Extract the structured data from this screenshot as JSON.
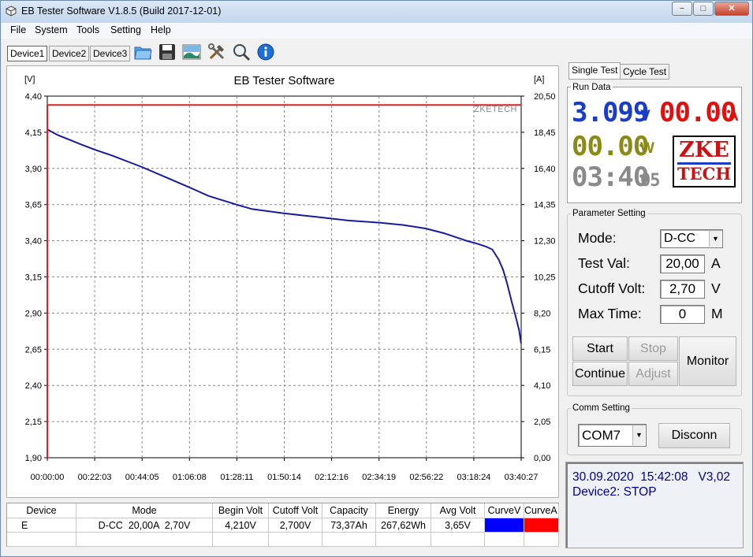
{
  "window": {
    "title": "EB Tester Software V1.8.5 (Build 2017-12-01)",
    "minimize_label": "−",
    "maximize_label": "□",
    "close_label": "✕"
  },
  "menu": [
    "File",
    "System",
    "Tools",
    "Setting",
    "Help"
  ],
  "device_tabs": [
    "Device1",
    "Device2",
    "Device3"
  ],
  "toolbar_icons": [
    "open-folder-icon",
    "save-icon",
    "chart-image-icon",
    "tools-icon",
    "zoom-icon",
    "info-icon"
  ],
  "chart_data": {
    "type": "line",
    "title": "EB Tester Software",
    "watermark": "ZKETECH",
    "ylabel_left": "[V]",
    "ylabel_right": "[A]",
    "y_left_ticks": [
      "4,40",
      "4,15",
      "3,90",
      "3,65",
      "3,40",
      "3,15",
      "2,90",
      "2,65",
      "2,40",
      "2,15",
      "1,90"
    ],
    "y_right_ticks": [
      "20,50",
      "18,45",
      "16,40",
      "14,35",
      "12,30",
      "10,25",
      "8,20",
      "6,15",
      "4,10",
      "2,05",
      "0,00"
    ],
    "x_ticks": [
      "00:00:00",
      "00:22:03",
      "00:44:05",
      "01:06:08",
      "01:28:11",
      "01:50:14",
      "02:12:16",
      "02:34:19",
      "02:56:22",
      "03:18:24",
      "03:40:27"
    ],
    "ylim_left": [
      1.9,
      4.4
    ],
    "ylim_right": [
      0,
      20.5
    ],
    "xlim_minutes": [
      0,
      220.45
    ],
    "grid": true,
    "series": [
      {
        "axis": "left",
        "color": "#1a1aa0",
        "x_minutes": [
          0,
          5,
          10,
          15,
          22,
          30,
          44,
          55,
          66,
          75,
          88,
          95,
          110,
          125,
          140,
          155,
          165,
          176,
          185,
          195,
          200,
          204,
          207,
          210,
          212,
          214,
          216,
          218,
          219.5,
          220.4
        ],
        "y_volts": [
          4.17,
          4.13,
          4.1,
          4.07,
          4.03,
          3.99,
          3.91,
          3.84,
          3.77,
          3.71,
          3.65,
          3.62,
          3.59,
          3.565,
          3.54,
          3.525,
          3.51,
          3.485,
          3.45,
          3.4,
          3.38,
          3.36,
          3.34,
          3.27,
          3.2,
          3.1,
          2.98,
          2.87,
          2.78,
          2.69
        ]
      },
      {
        "axis": "right",
        "color": "#e02020",
        "x_minutes": [
          0,
          0,
          220.45
        ],
        "y_amps": [
          0,
          20.0,
          20.0
        ]
      }
    ]
  },
  "table": {
    "headers": [
      "Device",
      "Mode",
      "Begin Volt",
      "Cutoff Volt",
      "Capacity",
      "Energy",
      "Avg Volt",
      "CurveV",
      "CurveA"
    ],
    "row": {
      "device": "E",
      "mode": "D-CC  20,00A  2,70V",
      "begin_volt": "4,210V",
      "cutoff_volt": "2,700V",
      "capacity": "73,37Ah",
      "energy": "267,62Wh",
      "avg_volt": "3,65V",
      "curve_v_color": "#0000ff",
      "curve_a_color": "#ff0000"
    }
  },
  "right_tabs": [
    "Single Test",
    "Cycle Test"
  ],
  "run_data": {
    "label": "Run Data",
    "voltage": "3.099",
    "voltage_unit": "V",
    "current": "00.00",
    "current_unit": "A",
    "power": "00.00",
    "power_unit": "W",
    "time": "03:40",
    "time_sec": "05",
    "logo_line1": "ZKE",
    "logo_line2": "TECH"
  },
  "params": {
    "label": "Parameter Setting",
    "mode_label": "Mode:",
    "mode_value": "D-CC",
    "testval_label": "Test Val:",
    "testval_value": "20,00",
    "testval_unit": "A",
    "cutoff_label": "Cutoff Volt:",
    "cutoff_value": "2,70",
    "cutoff_unit": "V",
    "maxtime_label": "Max Time:",
    "maxtime_value": "0",
    "maxtime_unit": "M"
  },
  "actions": {
    "start": "Start",
    "stop": "Stop",
    "continue": "Continue",
    "adjust": "Adjust",
    "monitor": "Monitor"
  },
  "comm": {
    "label": "Comm Setting",
    "port": "COM7",
    "disconnect": "Disconn"
  },
  "status": {
    "line1": "30.09.2020  15:42:08   V3,02",
    "line2": "Device2: STOP"
  }
}
